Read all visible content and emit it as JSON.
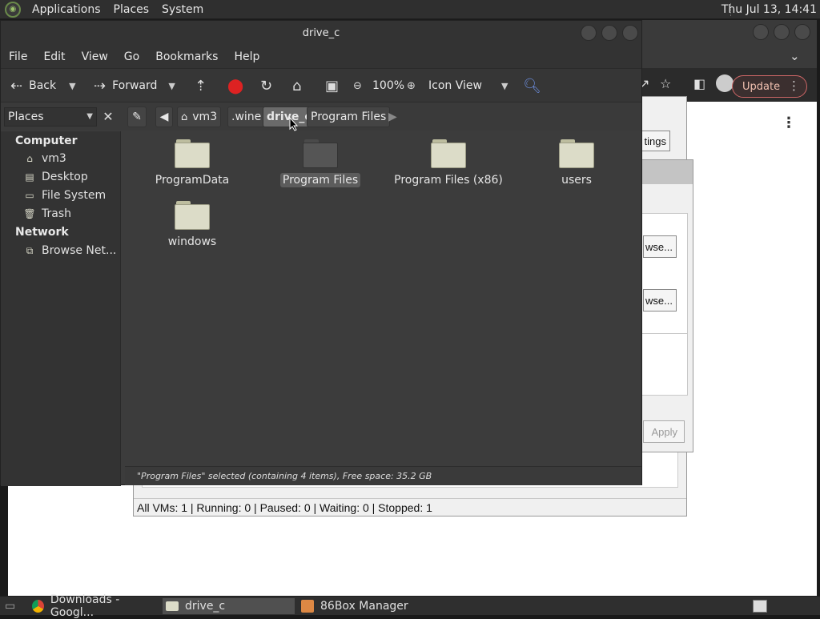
{
  "top_panel": {
    "menus": [
      "Applications",
      "Places",
      "System"
    ],
    "clock": "Thu Jul 13, 14:41"
  },
  "browser_bg": {
    "update_label": "Update"
  },
  "box_manager": {
    "settings_label": "tings",
    "status": "All VMs: 1 | Running: 0 | Paused: 0 | Waiting: 0 | Stopped: 1"
  },
  "dialog": {
    "browse_label_1": "wse...",
    "browse_label_2": "wse...",
    "apply_label": "Apply"
  },
  "file_manager": {
    "title": "drive_c",
    "menu": [
      "File",
      "Edit",
      "View",
      "Go",
      "Bookmarks",
      "Help"
    ],
    "toolbar": {
      "back": "Back",
      "forward": "Forward",
      "zoom": "100%",
      "view_mode": "Icon View"
    },
    "places_combo": "Places",
    "breadcrumbs": [
      "vm3",
      ".wine",
      "drive_c",
      "Program Files"
    ],
    "sidebar": {
      "computer_heading": "Computer",
      "computer_items": [
        "vm3",
        "Desktop",
        "File System",
        "Trash"
      ],
      "network_heading": "Network",
      "network_items": [
        "Browse Net..."
      ]
    },
    "files": [
      "ProgramData",
      "Program Files",
      "Program Files (x86)",
      "users",
      "windows"
    ],
    "selected_file": "Program Files",
    "status": "\"Program Files\" selected (containing 4 items), Free space: 35.2 GB"
  },
  "taskbar": {
    "tasks": [
      "Downloads - Googl...",
      "drive_c",
      "86Box Manager"
    ]
  }
}
